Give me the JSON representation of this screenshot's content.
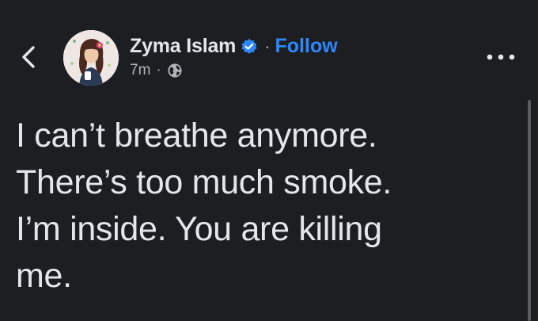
{
  "header": {
    "author_name": "Zyma Islam",
    "separator": "·",
    "follow_label": "Follow",
    "timestamp": "7m",
    "meta_separator": "·",
    "verified": true,
    "icons": {
      "back": "chevron-left-icon",
      "verified": "verified-badge-icon",
      "globe": "globe-icon",
      "more": "more-horizontal-icon"
    }
  },
  "post": {
    "lines": [
      "I can’t breathe anymore.",
      "There’s too much smoke.",
      "I’m inside. You are killing",
      "me."
    ]
  },
  "colors": {
    "background": "#1c1e21",
    "text": "#e4e6eb",
    "secondary_text": "#b0b3b8",
    "accent": "#2d88ff"
  }
}
